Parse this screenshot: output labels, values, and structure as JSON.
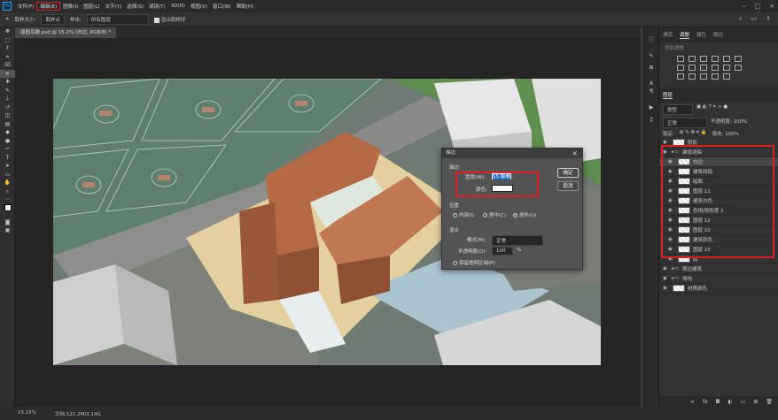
{
  "menu": [
    "文件(F)",
    "编辑(E)",
    "图像(I)",
    "图层(L)",
    "文字(Y)",
    "选择(S)",
    "滤镜(T)",
    "3D(D)",
    "视图(V)",
    "窗口(W)",
    "帮助(H)"
  ],
  "highlighted_menu": "编辑(E)",
  "options": {
    "sample_size_label": "取样大小:",
    "sample_size_value": "取样点",
    "sample_label": "样本:",
    "sample_value": "所有图层",
    "show_ring": "显示取样环"
  },
  "document_tab": "插图鸟瞰.psd @ 15.2% (白边, RGB/8) *",
  "status": {
    "zoom": "15.15%",
    "doc": "文档:122.2M/2.14G"
  },
  "panel_tabs": [
    "通道",
    "调整",
    "属性",
    "路径"
  ],
  "adjust_label": "添加调整",
  "layers_title": "图层",
  "layer_kind": "类型",
  "blend_mode": "正常",
  "opacity_label": "不透明度: 100%",
  "lock_label": "锁定:",
  "fill_label": "填充: 100%",
  "layers": [
    {
      "name": "阴影",
      "folder": false,
      "indent": 0
    },
    {
      "name": "建筑线稿",
      "folder": true,
      "indent": 0
    },
    {
      "name": "白边",
      "folder": false,
      "indent": 1,
      "selected": true
    },
    {
      "name": "建筑线稿",
      "folder": false,
      "indent": 1
    },
    {
      "name": "暗面",
      "folder": false,
      "indent": 1
    },
    {
      "name": "图层 11",
      "folder": false,
      "indent": 1
    },
    {
      "name": "建筑白色",
      "folder": false,
      "indent": 1
    },
    {
      "name": "色相/饱和度 2",
      "folder": false,
      "indent": 1
    },
    {
      "name": "图层 12",
      "folder": false,
      "indent": 1
    },
    {
      "name": "图层 10",
      "folder": false,
      "indent": 1
    },
    {
      "name": "建筑颜色",
      "folder": false,
      "indent": 1
    },
    {
      "name": "图层 10",
      "folder": false,
      "indent": 1
    },
    {
      "name": "底",
      "folder": false,
      "indent": 1
    },
    {
      "name": "周边建筑",
      "folder": true,
      "indent": 0
    },
    {
      "name": "场地",
      "folder": true,
      "indent": 0
    },
    {
      "name": "材质颜色",
      "folder": false,
      "indent": 0
    }
  ],
  "dialog": {
    "title": "描边",
    "section_stroke": "描边",
    "width_label": "宽度(W):",
    "width_value": "15 像素",
    "color_label": "颜色:",
    "section_position": "位置",
    "pos_inside": "内部(I)",
    "pos_center": "居中(C)",
    "pos_outside": "居外(U)",
    "section_blend": "混合",
    "mode_label": "模式(M):",
    "mode_value": "正常",
    "opacity_label": "不透明度(O):",
    "opacity_value": "100",
    "opacity_unit": "%",
    "preserve": "保留透明区域(P)",
    "ok": "确定",
    "cancel": "取消"
  }
}
